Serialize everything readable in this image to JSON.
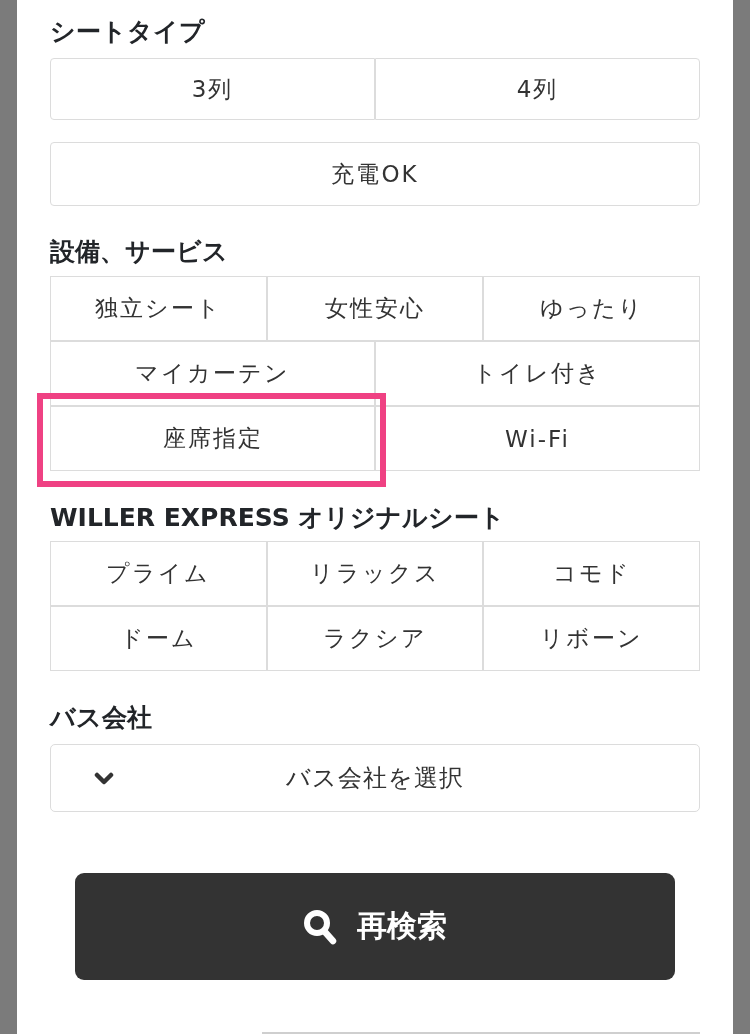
{
  "seat_type": {
    "title": "シートタイプ",
    "options": [
      {
        "label": "3列",
        "selected": false
      },
      {
        "label": "4列",
        "selected": false
      }
    ]
  },
  "charging": {
    "label": "充電OK",
    "selected": false
  },
  "facilities": {
    "title": "設備、サービス",
    "rows": [
      [
        {
          "label": "独立シート",
          "selected": false,
          "highlighted": false
        },
        {
          "label": "女性安心",
          "selected": false,
          "highlighted": false
        },
        {
          "label": "ゆったり",
          "selected": false,
          "highlighted": false
        }
      ],
      [
        {
          "label": "マイカーテン",
          "selected": false,
          "highlighted": false
        },
        {
          "label": "トイレ付き",
          "selected": false,
          "highlighted": false
        }
      ],
      [
        {
          "label": "座席指定",
          "selected": false,
          "highlighted": true
        },
        {
          "label": "Wi-Fi",
          "selected": false,
          "highlighted": false
        }
      ]
    ]
  },
  "original_seats": {
    "title": "WILLER EXPRESS オリジナルシート",
    "rows": [
      [
        {
          "label": "プライム",
          "selected": false
        },
        {
          "label": "リラックス",
          "selected": false
        },
        {
          "label": "コモド",
          "selected": false
        }
      ],
      [
        {
          "label": "ドーム",
          "selected": false
        },
        {
          "label": "ラクシア",
          "selected": false
        },
        {
          "label": "リボーン",
          "selected": false
        }
      ]
    ]
  },
  "bus_company": {
    "title": "バス会社",
    "select": {
      "placeholder": "バス会社を選択"
    }
  },
  "search_button": {
    "label": "再検索"
  }
}
